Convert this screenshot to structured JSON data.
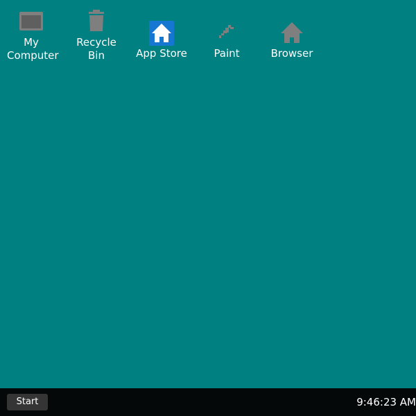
{
  "desktop": {
    "background_color": "#008080",
    "icons": [
      {
        "label": "My Computer",
        "icon": "computer-icon"
      },
      {
        "label": "Recycle Bin",
        "icon": "recycle-bin-icon"
      },
      {
        "label": "App Store",
        "icon": "app-store-icon"
      },
      {
        "label": "Paint",
        "icon": "paint-icon"
      },
      {
        "label": "Browser",
        "icon": "browser-icon"
      }
    ]
  },
  "taskbar": {
    "background_color": "#050808",
    "start_label": "Start",
    "clock": "9:46:23 AM"
  },
  "colors": {
    "icon_gray": "#7f7f7f",
    "app_store_blue": "#1677d2",
    "label_white": "#ffffff"
  }
}
